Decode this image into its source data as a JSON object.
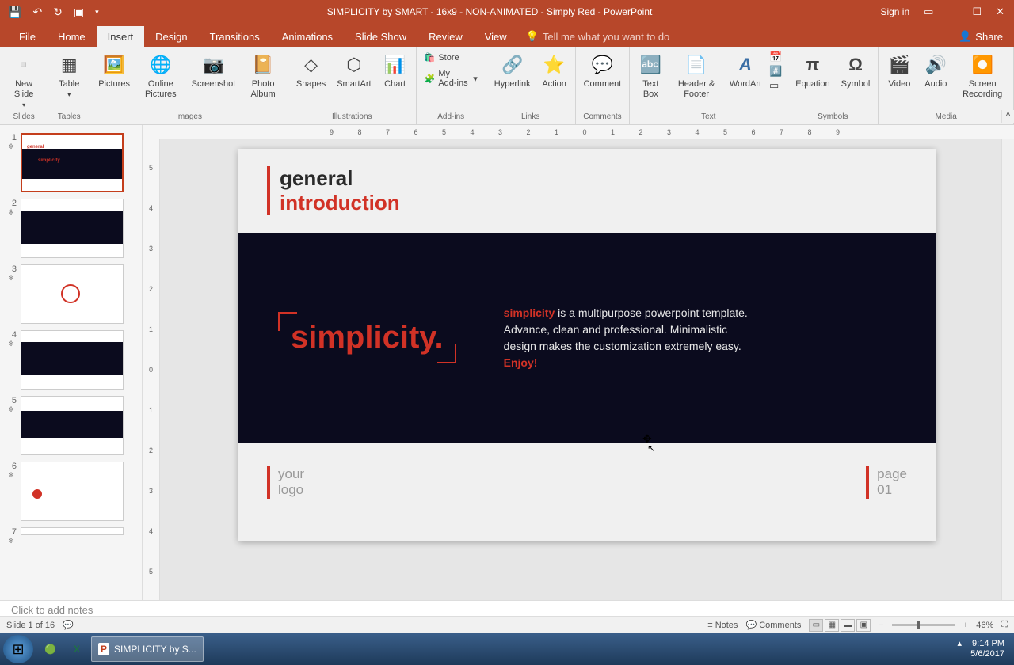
{
  "titlebar": {
    "title": "SIMPLICITY by SMART - 16x9 - NON-ANIMATED - Simply Red  -  PowerPoint",
    "signin": "Sign in"
  },
  "tabs": {
    "file": "File",
    "home": "Home",
    "insert": "Insert",
    "design": "Design",
    "transitions": "Transitions",
    "animations": "Animations",
    "slideshow": "Slide Show",
    "review": "Review",
    "view": "View",
    "tellme": "Tell me what you want to do",
    "share": "Share"
  },
  "ribbon": {
    "new_slide": "New Slide",
    "slides_group": "Slides",
    "table": "Table",
    "tables_group": "Tables",
    "pictures": "Pictures",
    "online_pictures": "Online Pictures",
    "screenshot": "Screenshot",
    "photo_album": "Photo Album",
    "images_group": "Images",
    "shapes": "Shapes",
    "smartart": "SmartArt",
    "chart": "Chart",
    "illustrations_group": "Illustrations",
    "store": "Store",
    "my_addins": "My Add-ins",
    "addins_group": "Add-ins",
    "hyperlink": "Hyperlink",
    "action": "Action",
    "links_group": "Links",
    "comment": "Comment",
    "comments_group": "Comments",
    "textbox": "Text Box",
    "header_footer": "Header & Footer",
    "wordart": "WordArt",
    "text_group": "Text",
    "equation": "Equation",
    "symbol": "Symbol",
    "symbols_group": "Symbols",
    "video": "Video",
    "audio": "Audio",
    "screen_recording": "Screen Recording",
    "media_group": "Media"
  },
  "slide": {
    "header_line1": "general",
    "header_line2": "introduction",
    "brand": "simplicity.",
    "desc_hl1": "simplicity",
    "desc_text": " is a multipurpose powerpoint template. Advance, clean and professional. Minimalistic design makes the customization extremely easy. ",
    "desc_hl2": "Enjoy!",
    "foot_logo1": "your",
    "foot_logo2": "logo",
    "foot_page1": "page",
    "foot_page2": "01"
  },
  "notes": {
    "placeholder": "Click to add notes"
  },
  "statusbar": {
    "slide_info": "Slide 1 of 16",
    "notes": "Notes",
    "comments": "Comments",
    "zoom": "46%"
  },
  "taskbar": {
    "app": "SIMPLICITY by S...",
    "time": "9:14 PM",
    "date": "5/6/2017"
  },
  "thumbs": {
    "count": 7
  },
  "ruler_h": "9 8 7 6 5 4 3 2 1 0 1 2 3 4 5 6 7 8 9",
  "ruler_v": [
    "5",
    "4",
    "3",
    "2",
    "1",
    "0",
    "1",
    "2",
    "3",
    "4",
    "5"
  ]
}
